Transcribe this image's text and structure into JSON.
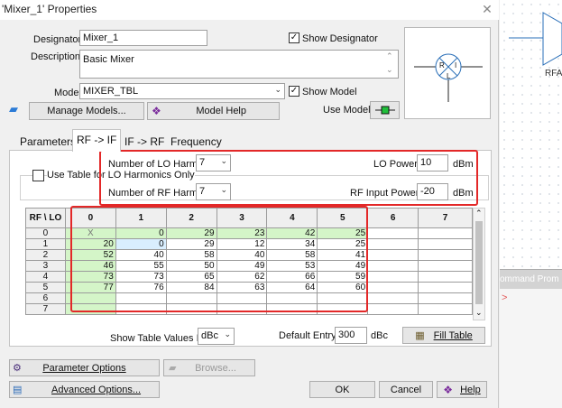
{
  "window": {
    "title": "'Mixer_1' Properties",
    "close_glyph": "✕"
  },
  "general": {
    "designator_label": "Designator:",
    "designator_value": "Mixer_1",
    "show_designator": "Show Designator",
    "description_label": "Description:",
    "description_value": "Basic Mixer",
    "model_label": "Model:",
    "model_value": "MIXER_TBL",
    "show_model": "Show Model",
    "use_model": "Use Model",
    "manage_models": "Manage Models...",
    "model_help": "Model Help"
  },
  "symbol": {
    "r": "R",
    "i": "I",
    "l": "L"
  },
  "tabs": [
    {
      "label": "Parameters"
    },
    {
      "label": "RF -> IF"
    },
    {
      "label": "IF -> RF"
    },
    {
      "label": "Frequency"
    }
  ],
  "rfif": {
    "use_table_label": "Use Table for LO Harmonics Only",
    "lo_harm_label": "Number of LO Harmonics:",
    "lo_harm_value": "7",
    "rf_harm_label": "Number of RF Harmonics:",
    "rf_harm_value": "7",
    "lo_power_label": "LO Power:",
    "lo_power_value": "10",
    "lo_power_unit": "dBm",
    "rf_power_label": "RF Input Power:",
    "rf_power_value": "-20",
    "rf_power_unit": "dBm",
    "show_values_label": "Show Table Values In:",
    "show_values_value": "dBc",
    "default_entry_label": "Default Entry:",
    "default_entry_value": "300",
    "default_entry_unit": "dBc",
    "fill_table": "Fill Table",
    "grid": {
      "corner": "RF \\ LO",
      "cols": [
        "0",
        "1",
        "2",
        "3",
        "4",
        "5",
        "6",
        "7"
      ],
      "rows": [
        {
          "h": "0",
          "v": [
            "X",
            "0",
            "29",
            "23",
            "42",
            "25",
            "",
            ""
          ]
        },
        {
          "h": "1",
          "v": [
            "20",
            "0",
            "29",
            "12",
            "34",
            "25",
            "",
            ""
          ]
        },
        {
          "h": "2",
          "v": [
            "52",
            "40",
            "58",
            "40",
            "58",
            "41",
            "",
            ""
          ]
        },
        {
          "h": "3",
          "v": [
            "46",
            "55",
            "50",
            "49",
            "53",
            "49",
            "",
            ""
          ]
        },
        {
          "h": "4",
          "v": [
            "73",
            "73",
            "65",
            "62",
            "66",
            "59",
            "",
            ""
          ]
        },
        {
          "h": "5",
          "v": [
            "77",
            "76",
            "84",
            "63",
            "64",
            "60",
            "",
            ""
          ]
        },
        {
          "h": "6",
          "v": [
            "",
            "",
            "",
            "",
            "",
            "",
            "",
            ""
          ]
        },
        {
          "h": "7",
          "v": [
            "",
            "",
            "",
            "",
            "",
            "",
            "",
            ""
          ]
        }
      ]
    }
  },
  "footer": {
    "parameter_options": "Parameter Options",
    "browse": "Browse...",
    "advanced_options": "Advanced Options...",
    "ok": "OK",
    "cancel": "Cancel",
    "help": "Help"
  },
  "background": {
    "rfa_label": "RFAI",
    "command_prompt": "ommand Prom"
  }
}
